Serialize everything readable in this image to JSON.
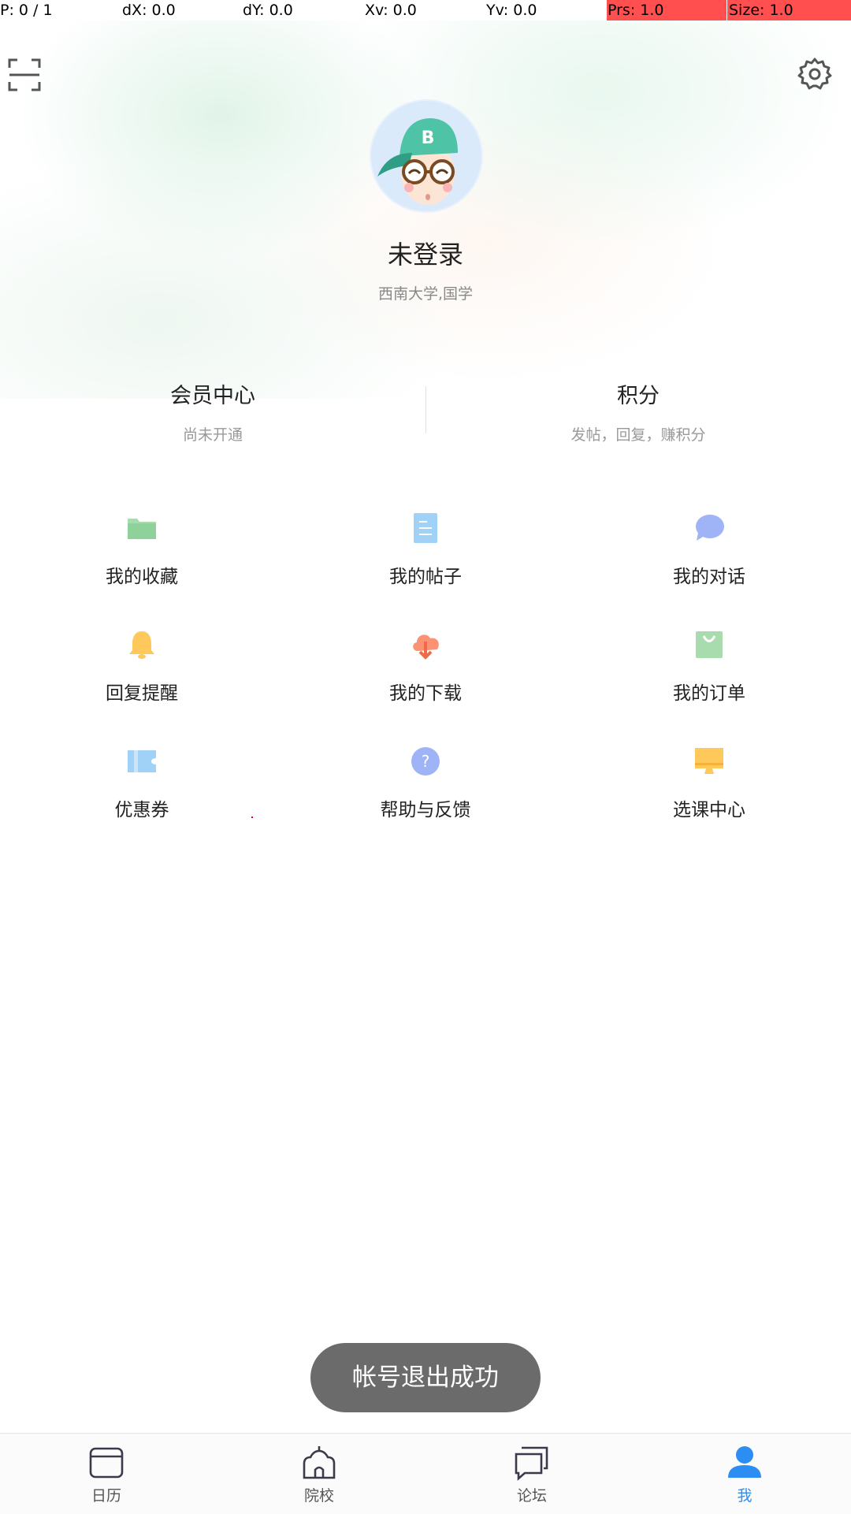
{
  "debug": {
    "p": "P: 0 / 1",
    "dx": "dX: 0.0",
    "dy": "dY: 0.0",
    "xv": "Xv: 0.0",
    "yv": "Yv: 0.0",
    "prs": "Prs: 1.0",
    "size": "Size: 1.0"
  },
  "header": {
    "scan_icon": "scan-icon",
    "settings_icon": "gear-icon",
    "avatar_letter": "B"
  },
  "user": {
    "name": "未登录",
    "school": "西南大学,国学"
  },
  "stats": [
    {
      "title": "会员中心",
      "subtitle": "尚未开通"
    },
    {
      "title": "积分",
      "subtitle": "发帖，回复，赚积分"
    }
  ],
  "menu": [
    {
      "label": "我的收藏",
      "icon": "folder-icon",
      "color": "#a8dcae"
    },
    {
      "label": "我的帖子",
      "icon": "document-icon",
      "color": "#9fd2f6"
    },
    {
      "label": "我的对话",
      "icon": "chat-bubble-icon",
      "color": "#9fb3f7"
    },
    {
      "label": "回复提醒",
      "icon": "bell-icon",
      "color": "#ffc85a"
    },
    {
      "label": "我的下载",
      "icon": "cloud-download-icon",
      "color": "#f99374"
    },
    {
      "label": "我的订单",
      "icon": "shopping-bag-icon",
      "color": "#a8dcae"
    },
    {
      "label": "优惠券",
      "icon": "ticket-icon",
      "color": "#9fd2f6"
    },
    {
      "label": "帮助与反馈",
      "icon": "help-icon",
      "color": "#9fb3f7"
    },
    {
      "label": "选课中心",
      "icon": "monitor-icon",
      "color": "#ffc85a"
    }
  ],
  "toast": "帐号退出成功",
  "nav": [
    {
      "label": "日历",
      "icon": "calendar-icon"
    },
    {
      "label": "院校",
      "icon": "school-icon"
    },
    {
      "label": "论坛",
      "icon": "forum-icon"
    },
    {
      "label": "我",
      "icon": "person-icon",
      "active": true
    }
  ],
  "colors": {
    "accent": "#2c8ef2",
    "toast_bg": "#6b6b6b",
    "debug_red": "#ff4f4f"
  }
}
